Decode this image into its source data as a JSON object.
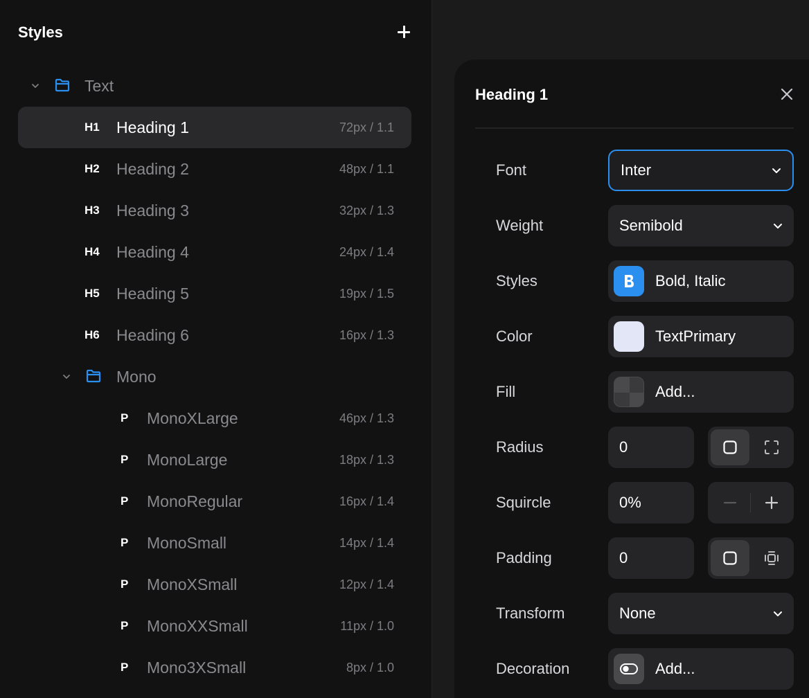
{
  "styles_panel": {
    "title": "Styles",
    "group_text": {
      "label": "Text"
    },
    "headings": [
      {
        "tag": "H1",
        "name": "Heading 1",
        "meta": "72px / 1.1"
      },
      {
        "tag": "H2",
        "name": "Heading 2",
        "meta": "48px / 1.1"
      },
      {
        "tag": "H3",
        "name": "Heading 3",
        "meta": "32px / 1.3"
      },
      {
        "tag": "H4",
        "name": "Heading 4",
        "meta": "24px / 1.4"
      },
      {
        "tag": "H5",
        "name": "Heading 5",
        "meta": "19px / 1.5"
      },
      {
        "tag": "H6",
        "name": "Heading 6",
        "meta": "16px / 1.3"
      }
    ],
    "group_mono": {
      "label": "Mono"
    },
    "mono_items": [
      {
        "tag": "P",
        "name": "MonoXLarge",
        "meta": "46px / 1.3"
      },
      {
        "tag": "P",
        "name": "MonoLarge",
        "meta": "18px / 1.3"
      },
      {
        "tag": "P",
        "name": "MonoRegular",
        "meta": "16px / 1.4"
      },
      {
        "tag": "P",
        "name": "MonoSmall",
        "meta": "14px / 1.4"
      },
      {
        "tag": "P",
        "name": "MonoXSmall",
        "meta": "12px / 1.4"
      },
      {
        "tag": "P",
        "name": "MonoXXSmall",
        "meta": "11px / 1.0"
      },
      {
        "tag": "P",
        "name": "Mono3XSmall",
        "meta": "8px / 1.0"
      }
    ]
  },
  "editor": {
    "title": "Heading 1",
    "font": {
      "label": "Font",
      "value": "Inter"
    },
    "weight": {
      "label": "Weight",
      "value": "Semibold"
    },
    "styles": {
      "label": "Styles",
      "value": "Bold, Italic"
    },
    "color": {
      "label": "Color",
      "value": "TextPrimary"
    },
    "fill": {
      "label": "Fill",
      "placeholder": "Add..."
    },
    "radius": {
      "label": "Radius",
      "value": "0"
    },
    "squircle": {
      "label": "Squircle",
      "value": "0%"
    },
    "padding": {
      "label": "Padding",
      "value": "0"
    },
    "transform": {
      "label": "Transform",
      "value": "None"
    },
    "decoration": {
      "label": "Decoration",
      "placeholder": "Add..."
    }
  },
  "colors": {
    "accent": "#2b8ff0",
    "text_primary_swatch": "#e3e6f7",
    "panel_bg": "#121213",
    "field_bg": "#252527",
    "selected_row": "#29292b"
  }
}
